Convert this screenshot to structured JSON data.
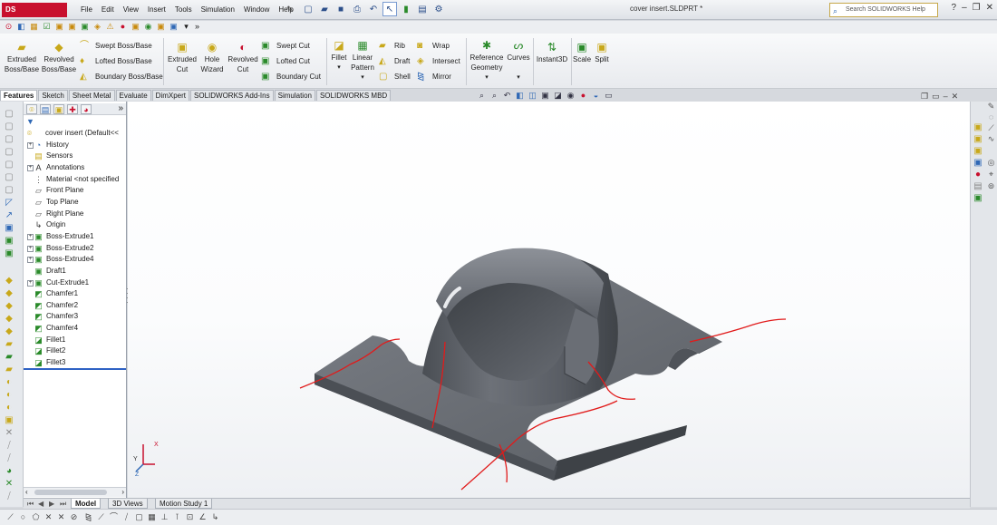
{
  "app": {
    "logo": "DS SOLIDWORKS",
    "document_title": "cover insert.SLDPRT *"
  },
  "menu": [
    "File",
    "Edit",
    "View",
    "Insert",
    "Tools",
    "Simulation",
    "Window",
    "Help"
  ],
  "help_search": {
    "placeholder": "Search SOLIDWORKS Help"
  },
  "command_manager": {
    "extruded_boss": "Extruded\nBoss/Base",
    "revolved_boss": "Revolved\nBoss/Base",
    "swept_boss": "Swept Boss/Base",
    "lofted_boss": "Lofted Boss/Base",
    "boundary_boss": "Boundary Boss/Base",
    "extruded_cut": "Extruded\nCut",
    "hole_wizard": "Hole\nWizard",
    "revolved_cut": "Revolved\nCut",
    "swept_cut": "Swept Cut",
    "lofted_cut": "Lofted Cut",
    "boundary_cut": "Boundary Cut",
    "fillet": "Fillet",
    "linear_pattern": "Linear\nPattern",
    "rib": "Rib",
    "draft": "Draft",
    "shell": "Shell",
    "wrap": "Wrap",
    "intersect": "Intersect",
    "mirror": "Mirror",
    "reference_geometry": "Reference\nGeometry",
    "curves": "Curves",
    "instant3d": "Instant3D",
    "scale": "Scale",
    "split": "Split"
  },
  "tabs": [
    "Features",
    "Sketch",
    "Sheet Metal",
    "Evaluate",
    "DimXpert",
    "SOLIDWORKS Add-Ins",
    "Simulation",
    "SOLIDWORKS MBD"
  ],
  "active_tab": "Features",
  "feature_tree": [
    {
      "label": "cover insert  (Default<<",
      "icon": "part-icon"
    },
    {
      "label": "History",
      "icon": "history-icon"
    },
    {
      "label": "Sensors",
      "icon": "sensors-icon"
    },
    {
      "label": "Annotations",
      "icon": "annotations-icon"
    },
    {
      "label": "Material <not specified",
      "icon": "material-icon"
    },
    {
      "label": "Front Plane",
      "icon": "plane-icon"
    },
    {
      "label": "Top Plane",
      "icon": "plane-icon"
    },
    {
      "label": "Right Plane",
      "icon": "plane-icon"
    },
    {
      "label": "Origin",
      "icon": "origin-icon"
    },
    {
      "label": "Boss-Extrude1",
      "icon": "extrude-icon"
    },
    {
      "label": "Boss-Extrude2",
      "icon": "extrude-icon"
    },
    {
      "label": "Boss-Extrude4",
      "icon": "extrude-icon"
    },
    {
      "label": "Draft1",
      "icon": "draft-icon"
    },
    {
      "label": "Cut-Extrude1",
      "icon": "cut-icon"
    },
    {
      "label": "Chamfer1",
      "icon": "chamfer-icon"
    },
    {
      "label": "Chamfer2",
      "icon": "chamfer-icon"
    },
    {
      "label": "Chamfer3",
      "icon": "chamfer-icon"
    },
    {
      "label": "Chamfer4",
      "icon": "chamfer-icon"
    },
    {
      "label": "Fillet1",
      "icon": "fillet-icon"
    },
    {
      "label": "Fillet2",
      "icon": "fillet-icon"
    },
    {
      "label": "Fillet3",
      "icon": "fillet-icon"
    }
  ],
  "bottom_tabs": [
    "Model",
    "3D Views",
    "Motion Study 1"
  ],
  "active_bottom_tab": "Model",
  "triad": {
    "x": "X",
    "y": "Y",
    "z": "Z"
  },
  "colors": {
    "accent": "#2f62c4",
    "brand": "#c8102e",
    "part_gray": "#5d6168",
    "sketch_red": "#e11b1b"
  }
}
